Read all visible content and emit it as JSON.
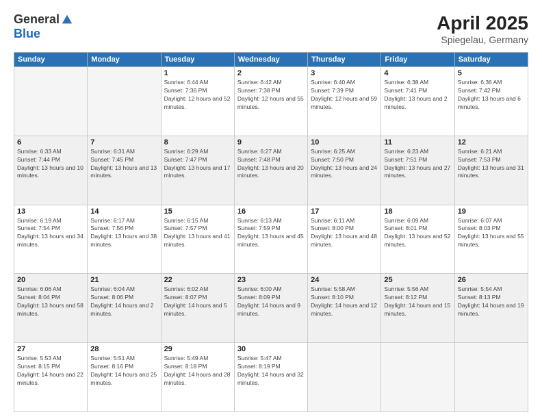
{
  "header": {
    "logo_general": "General",
    "logo_blue": "Blue",
    "title": "April 2025",
    "location": "Spiegelau, Germany"
  },
  "weekdays": [
    "Sunday",
    "Monday",
    "Tuesday",
    "Wednesday",
    "Thursday",
    "Friday",
    "Saturday"
  ],
  "weeks": [
    [
      {
        "day": "",
        "info": ""
      },
      {
        "day": "",
        "info": ""
      },
      {
        "day": "1",
        "info": "Sunrise: 6:44 AM\nSunset: 7:36 PM\nDaylight: 12 hours and 52 minutes."
      },
      {
        "day": "2",
        "info": "Sunrise: 6:42 AM\nSunset: 7:38 PM\nDaylight: 12 hours and 55 minutes."
      },
      {
        "day": "3",
        "info": "Sunrise: 6:40 AM\nSunset: 7:39 PM\nDaylight: 12 hours and 59 minutes."
      },
      {
        "day": "4",
        "info": "Sunrise: 6:38 AM\nSunset: 7:41 PM\nDaylight: 13 hours and 2 minutes."
      },
      {
        "day": "5",
        "info": "Sunrise: 6:36 AM\nSunset: 7:42 PM\nDaylight: 13 hours and 6 minutes."
      }
    ],
    [
      {
        "day": "6",
        "info": "Sunrise: 6:33 AM\nSunset: 7:44 PM\nDaylight: 13 hours and 10 minutes."
      },
      {
        "day": "7",
        "info": "Sunrise: 6:31 AM\nSunset: 7:45 PM\nDaylight: 13 hours and 13 minutes."
      },
      {
        "day": "8",
        "info": "Sunrise: 6:29 AM\nSunset: 7:47 PM\nDaylight: 13 hours and 17 minutes."
      },
      {
        "day": "9",
        "info": "Sunrise: 6:27 AM\nSunset: 7:48 PM\nDaylight: 13 hours and 20 minutes."
      },
      {
        "day": "10",
        "info": "Sunrise: 6:25 AM\nSunset: 7:50 PM\nDaylight: 13 hours and 24 minutes."
      },
      {
        "day": "11",
        "info": "Sunrise: 6:23 AM\nSunset: 7:51 PM\nDaylight: 13 hours and 27 minutes."
      },
      {
        "day": "12",
        "info": "Sunrise: 6:21 AM\nSunset: 7:53 PM\nDaylight: 13 hours and 31 minutes."
      }
    ],
    [
      {
        "day": "13",
        "info": "Sunrise: 6:19 AM\nSunset: 7:54 PM\nDaylight: 13 hours and 34 minutes."
      },
      {
        "day": "14",
        "info": "Sunrise: 6:17 AM\nSunset: 7:56 PM\nDaylight: 13 hours and 38 minutes."
      },
      {
        "day": "15",
        "info": "Sunrise: 6:15 AM\nSunset: 7:57 PM\nDaylight: 13 hours and 41 minutes."
      },
      {
        "day": "16",
        "info": "Sunrise: 6:13 AM\nSunset: 7:59 PM\nDaylight: 13 hours and 45 minutes."
      },
      {
        "day": "17",
        "info": "Sunrise: 6:11 AM\nSunset: 8:00 PM\nDaylight: 13 hours and 48 minutes."
      },
      {
        "day": "18",
        "info": "Sunrise: 6:09 AM\nSunset: 8:01 PM\nDaylight: 13 hours and 52 minutes."
      },
      {
        "day": "19",
        "info": "Sunrise: 6:07 AM\nSunset: 8:03 PM\nDaylight: 13 hours and 55 minutes."
      }
    ],
    [
      {
        "day": "20",
        "info": "Sunrise: 6:06 AM\nSunset: 8:04 PM\nDaylight: 13 hours and 58 minutes."
      },
      {
        "day": "21",
        "info": "Sunrise: 6:04 AM\nSunset: 8:06 PM\nDaylight: 14 hours and 2 minutes."
      },
      {
        "day": "22",
        "info": "Sunrise: 6:02 AM\nSunset: 8:07 PM\nDaylight: 14 hours and 5 minutes."
      },
      {
        "day": "23",
        "info": "Sunrise: 6:00 AM\nSunset: 8:09 PM\nDaylight: 14 hours and 9 minutes."
      },
      {
        "day": "24",
        "info": "Sunrise: 5:58 AM\nSunset: 8:10 PM\nDaylight: 14 hours and 12 minutes."
      },
      {
        "day": "25",
        "info": "Sunrise: 5:56 AM\nSunset: 8:12 PM\nDaylight: 14 hours and 15 minutes."
      },
      {
        "day": "26",
        "info": "Sunrise: 5:54 AM\nSunset: 8:13 PM\nDaylight: 14 hours and 19 minutes."
      }
    ],
    [
      {
        "day": "27",
        "info": "Sunrise: 5:53 AM\nSunset: 8:15 PM\nDaylight: 14 hours and 22 minutes."
      },
      {
        "day": "28",
        "info": "Sunrise: 5:51 AM\nSunset: 8:16 PM\nDaylight: 14 hours and 25 minutes."
      },
      {
        "day": "29",
        "info": "Sunrise: 5:49 AM\nSunset: 8:18 PM\nDaylight: 14 hours and 28 minutes."
      },
      {
        "day": "30",
        "info": "Sunrise: 5:47 AM\nSunset: 8:19 PM\nDaylight: 14 hours and 32 minutes."
      },
      {
        "day": "",
        "info": ""
      },
      {
        "day": "",
        "info": ""
      },
      {
        "day": "",
        "info": ""
      }
    ]
  ]
}
